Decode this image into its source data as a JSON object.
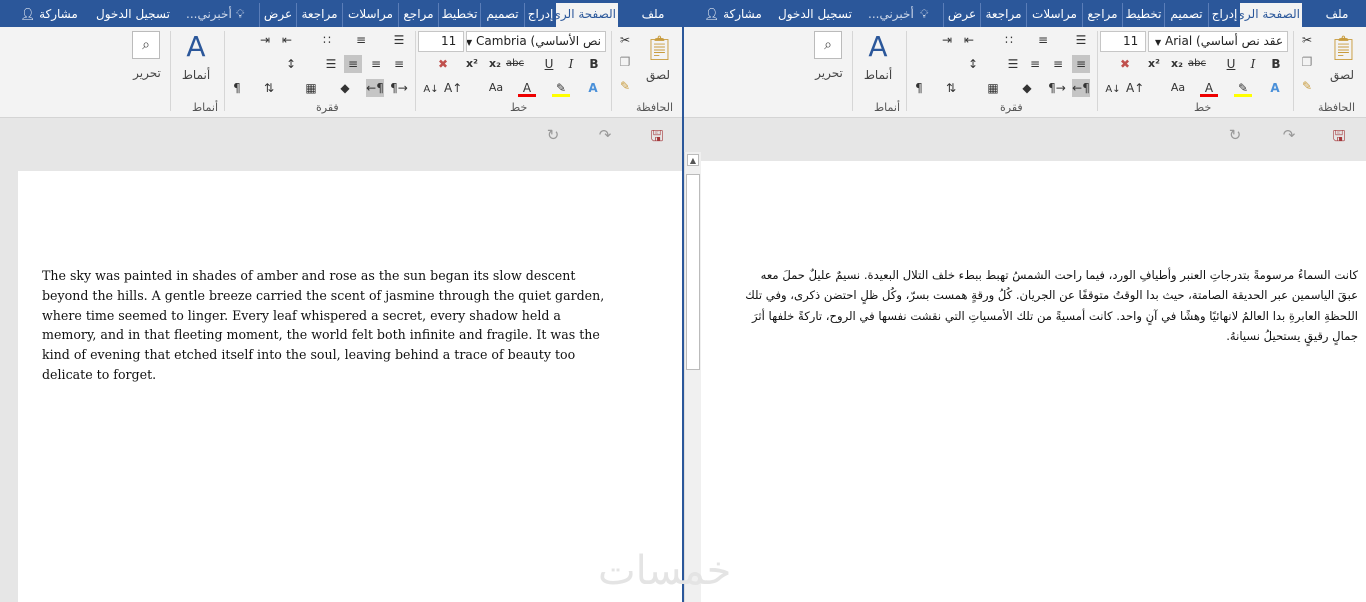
{
  "left_window": {
    "tabs": {
      "file": "ملف",
      "home": "الصفحة الرئ",
      "insert": "إدراج",
      "design": "تصميم",
      "layout": "تخطيط",
      "references": "مراجع",
      "mailings": "مراسلات",
      "review": "مراجعة",
      "view": "عرض"
    },
    "tell_me": "أخبرني...",
    "sign_in": "تسجيل الدخول",
    "share": "مشاركة",
    "ribbon": {
      "paste": "لصق",
      "clipboard_group": "الحافظة",
      "font_name": "Cambria",
      "style_name": "نص الأساسي)",
      "font_size": "11",
      "font_group": "خط",
      "paragraph_group": "فقرة",
      "styles_label": "أنماط",
      "styles_group": "أنماط",
      "editing_label": "تحرير"
    },
    "document_text": "The sky was painted in shades of amber and rose as the sun began its slow descent beyond the hills. A gentle breeze carried the scent of jasmine through the quiet garden, where time seemed to linger. Every leaf whispered a secret, every shadow held a memory, and in that fleeting moment, the world felt both infinite and fragile. It was the kind of evening that etched itself into the soul, leaving behind a trace of beauty too delicate to forget."
  },
  "right_window": {
    "tabs": {
      "file": "ملف",
      "home": "الصفحة الرئ",
      "insert": "إدراج",
      "design": "تصميم",
      "layout": "تخطيط",
      "references": "مراجع",
      "mailings": "مراسلات",
      "review": "مراجعة",
      "view": "عرض"
    },
    "tell_me": "أخبرني...",
    "sign_in": "تسجيل الدخول",
    "share": "مشاركة",
    "ribbon": {
      "paste": "لصق",
      "clipboard_group": "الحافظة",
      "font_name": "Arial",
      "style_name": "عقد نص أساسي)",
      "font_size": "11",
      "font_group": "خط",
      "paragraph_group": "فقرة",
      "styles_label": "أنماط",
      "styles_group": "أنماط",
      "editing_label": "تحرير"
    },
    "document_text": "كانت السماءُ مرسومةً بتدرجاتِ العنبر وأطيافِ الورد، فيما راحت الشمسُ تهبط ببطء خلف التلال البعيدة. نسيمٌ عليلٌ حملَ معه عبقَ الياسمين عبر الحديقة الصامتة، حيث بدا الوقتُ متوقفًا عن الجريان. كُلُ ورقةٍ همست بسرّ، وكُل ظلٍ احتضن ذكرى، وفي تلك اللحظةِ العابرةِ بدا العالمُ لانهائيًا وهشًا في آنٍ واحد. كانت أمسيةً من تلك الأمسياتِ التي نقشت نفسها في الروح، تاركةً خلفها أثرَ جمالٍ رقيقٍ يستحيلُ نسيانهُ."
  },
  "watermark": "خمسات",
  "colors": {
    "accent": "#2b579a",
    "ribbon": "#f3f3f3",
    "canvas": "#e6e6e6",
    "save_icon": "#a4373a"
  }
}
